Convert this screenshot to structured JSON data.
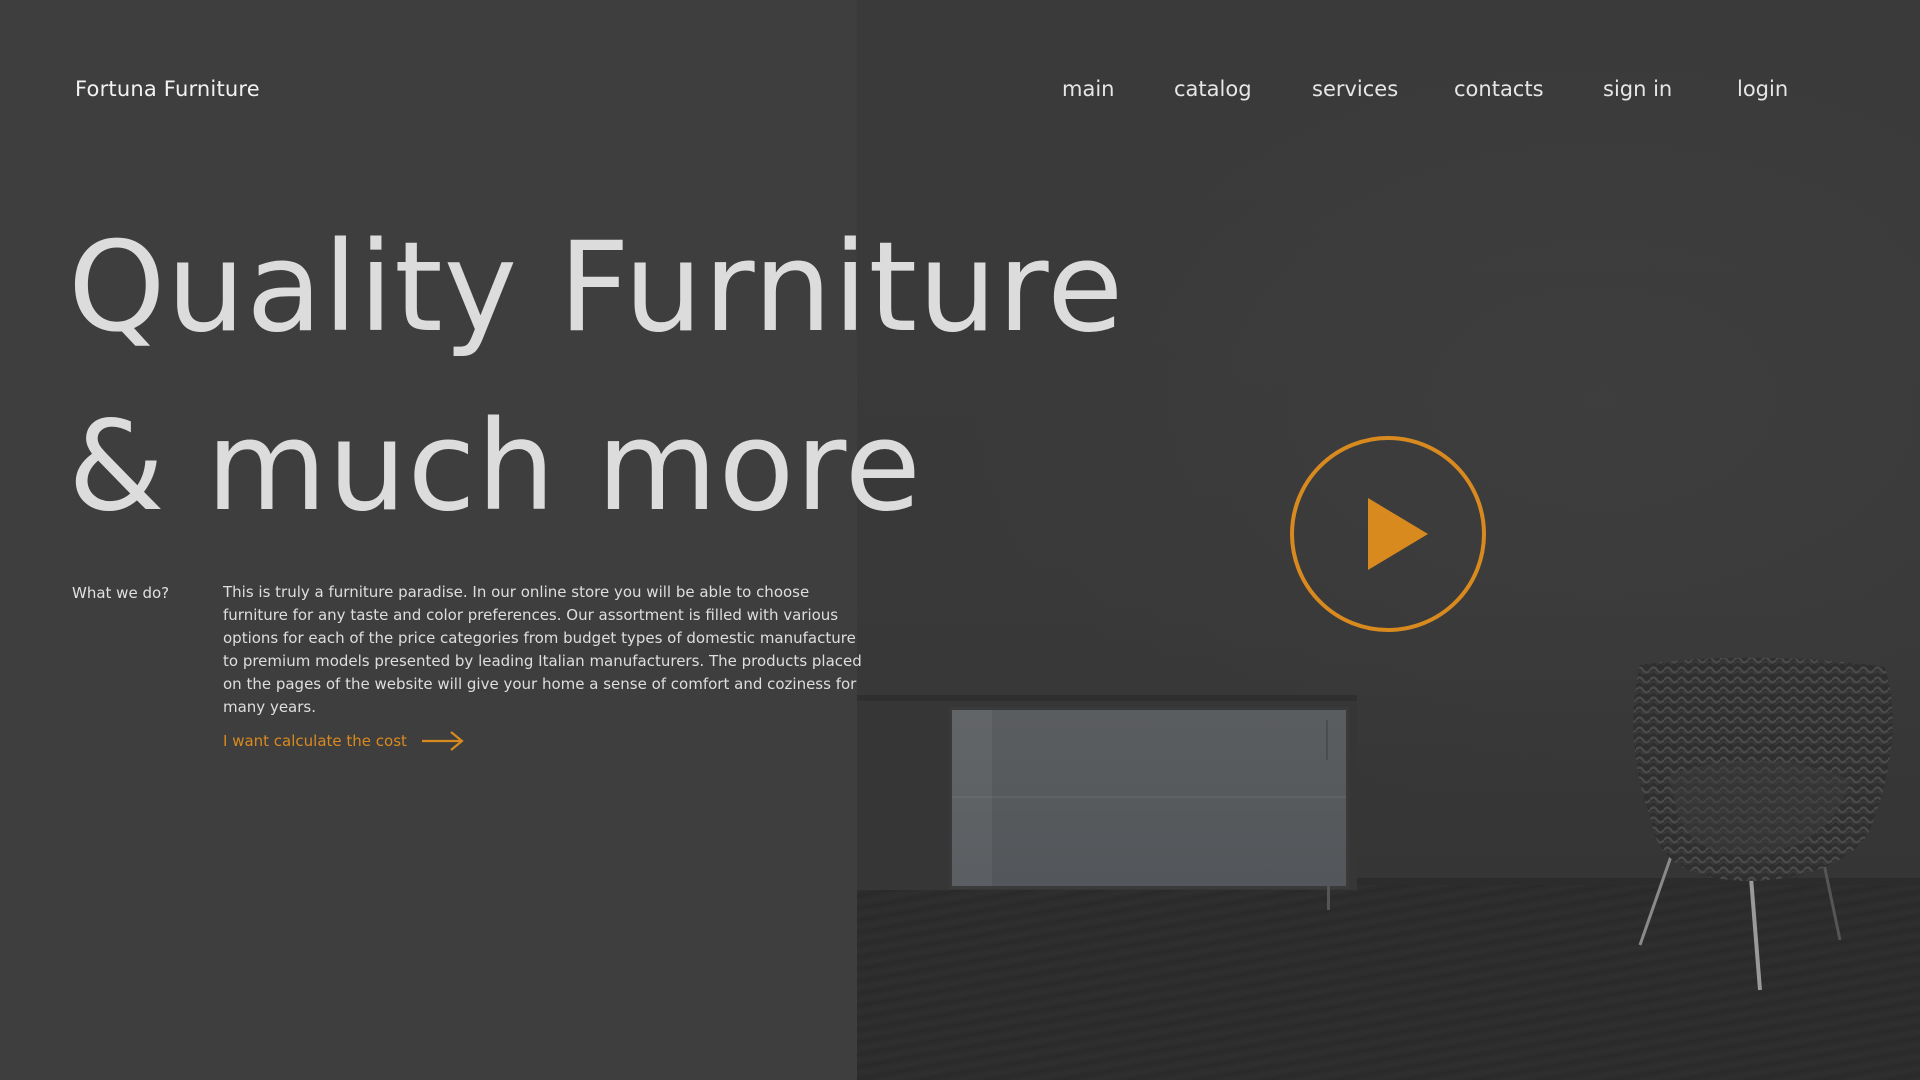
{
  "brand": {
    "logo_text": "Fortuna Furniture"
  },
  "nav": {
    "items": [
      {
        "label": "main"
      },
      {
        "label": "catalog"
      },
      {
        "label": "services"
      },
      {
        "label": "contacts"
      },
      {
        "label": "sign in"
      },
      {
        "label": "login"
      }
    ]
  },
  "hero": {
    "title_line_1": "Quality Furniture",
    "title_line_2": "& much more",
    "what_label": "What we do?",
    "description": "This is truly a furniture paradise. In our online store you will be able to choose furniture for any taste and color preferences. Our assortment is filled with various options for each of the price categories from budget types of domestic manufacture to premium models presented by leading Italian manufacturers. The products placed on the pages of the website will give your home a sense of comfort and coziness for many years.",
    "cta_label": "I want calculate the cost",
    "cta_icon": "arrow-right-icon"
  },
  "media": {
    "play_icon": "play-icon"
  },
  "colors": {
    "background": "#3e3e3e",
    "accent": "#d98a1f",
    "heading": "#dcdcdc",
    "text": "#dedede"
  }
}
